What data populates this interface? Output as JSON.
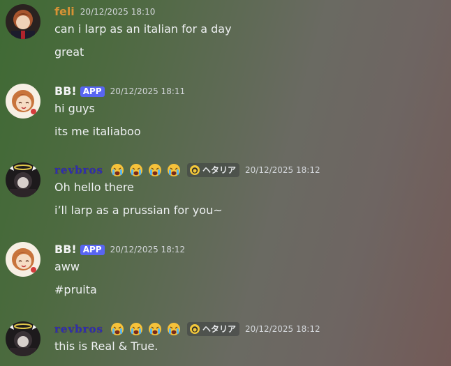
{
  "colors": {
    "feli_name": "#d79235",
    "bb_name": "#f3f4f5",
    "revbros_name": "#2b2fb4",
    "app_badge": "#5865f2",
    "timestamp": "#d3d6da"
  },
  "messages": [
    {
      "username": "feli",
      "timestamp": "20/12/2025 18:10",
      "lines": [
        "can i larp as an italian for a day",
        "great"
      ]
    },
    {
      "username": "BB!",
      "badge": "APP",
      "timestamp": "20/12/2025 18:11",
      "lines": [
        "hi guys",
        "its me italiaboo"
      ]
    },
    {
      "username": "revbros",
      "emojis": [
        "crying-emoji",
        "crying-emoji",
        "crying-emoji",
        "crying-emoji"
      ],
      "tag": "ヘタリア",
      "timestamp": "20/12/2025 18:12",
      "lines": [
        "Oh hello there",
        "i’ll larp as a prussian for you~"
      ]
    },
    {
      "username": "BB!",
      "badge": "APP",
      "timestamp": "20/12/2025 18:12",
      "lines": [
        "aww",
        "#pruita"
      ]
    },
    {
      "username": "revbros",
      "emojis": [
        "crying-emoji",
        "crying-emoji",
        "crying-emoji",
        "crying-emoji"
      ],
      "tag": "ヘタリア",
      "timestamp": "20/12/2025 18:12",
      "lines": [
        "this is Real & True."
      ]
    }
  ]
}
